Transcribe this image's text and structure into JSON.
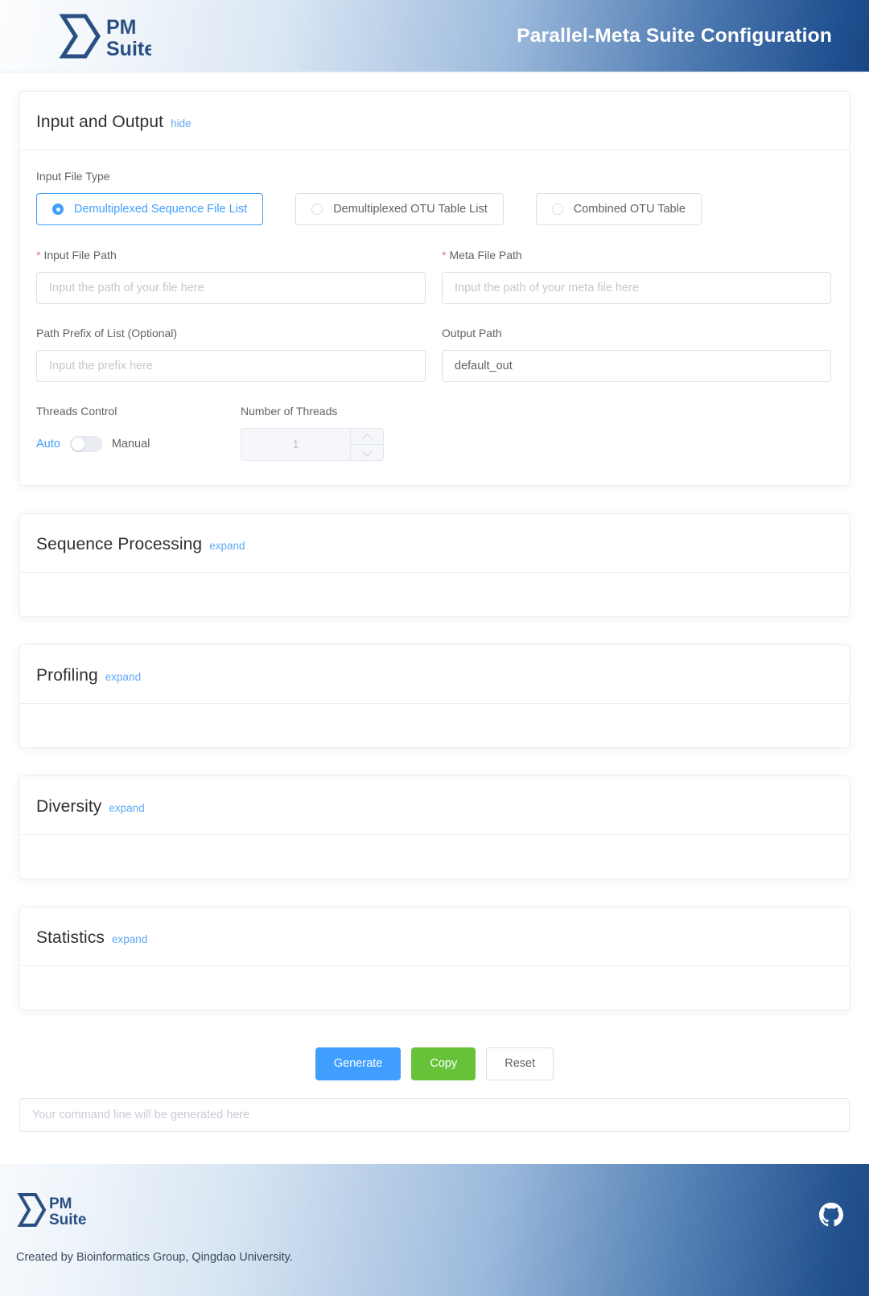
{
  "header": {
    "title": "Parallel-Meta Suite Configuration",
    "logo_line1": "PM",
    "logo_line2": "Suite",
    "logo_icon": "chevron-logo-icon"
  },
  "sections": {
    "input_output": {
      "title": "Input and Output",
      "toggle_label": "hide",
      "input_file_type_label": "Input File Type",
      "radio_options": [
        {
          "label": "Demultiplexed Sequence File List",
          "selected": true
        },
        {
          "label": "Demultiplexed OTU Table List",
          "selected": false
        },
        {
          "label": "Combined OTU Table",
          "selected": false
        }
      ],
      "fields": {
        "input_file_path": {
          "label": "Input File Path",
          "required_mark": "*",
          "placeholder": "Input the path of your file here",
          "value": ""
        },
        "meta_file_path": {
          "label": "Meta File Path",
          "required_mark": "*",
          "placeholder": "Input the path of your meta file here",
          "value": ""
        },
        "path_prefix": {
          "label": "Path Prefix of List (Optional)",
          "placeholder": "Input the prefix here",
          "value": ""
        },
        "output_path": {
          "label": "Output Path",
          "placeholder": "",
          "value": "default_out"
        }
      },
      "threads": {
        "control_label": "Threads Control",
        "number_label": "Number of Threads",
        "auto_label": "Auto",
        "manual_label": "Manual",
        "mode": "Auto",
        "number_value": "1"
      }
    },
    "sequence_processing": {
      "title": "Sequence Processing",
      "toggle_label": "expand"
    },
    "profiling": {
      "title": "Profiling",
      "toggle_label": "expand"
    },
    "diversity": {
      "title": "Diversity",
      "toggle_label": "expand"
    },
    "statistics": {
      "title": "Statistics",
      "toggle_label": "expand"
    }
  },
  "actions": {
    "generate": "Generate",
    "copy": "Copy",
    "reset": "Reset"
  },
  "command_line": {
    "placeholder": "Your command line will be generated here",
    "value": ""
  },
  "footer": {
    "logo_line1": "PM",
    "logo_line2": "Suite",
    "credit": "Created by Bioinformatics Group, Qingdao University.",
    "github_icon": "github-icon"
  },
  "colors": {
    "primary": "#409eff",
    "success": "#67c23a",
    "required": "#f56c6c",
    "link": "#5fa8f5",
    "header_dark": "#1b4684",
    "text": "#606266",
    "title": "#303133"
  }
}
